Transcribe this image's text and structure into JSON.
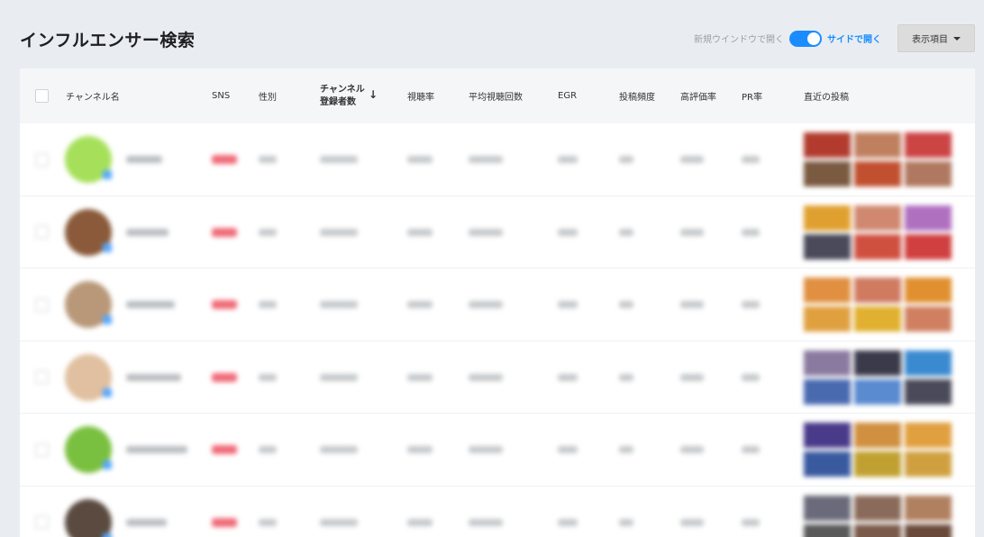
{
  "page": {
    "title": "インフルエンサー検索"
  },
  "controls": {
    "new_window_label": "新規ウインドウで開く",
    "toggle_on": true,
    "side_open_label": "サイドで開く",
    "columns_button_label": "表示項目",
    "accent_color": "#1a8cff"
  },
  "table": {
    "headers": {
      "channel_name": "チャンネル名",
      "sns": "SNS",
      "gender": "性別",
      "subscribers_line1": "チャンネル",
      "subscribers_line2": "登録者数",
      "sort_arrow": "↓",
      "view_rate": "視聴率",
      "avg_views": "平均視聴回数",
      "egr": "EGR",
      "post_frequency": "投稿頻度",
      "rating_rate": "高評価率",
      "pr_rate": "PR率",
      "recent_posts": "直近の投稿"
    },
    "rows": [
      {
        "avatar_color": "#a6e05a",
        "thumbs": [
          "#b23b2e",
          "#c08060",
          "#cc4444",
          "#7a5a40",
          "#c05030",
          "#b07860"
        ]
      },
      {
        "avatar_color": "#8a5a3a",
        "thumbs": [
          "#e0a030",
          "#d08870",
          "#b070c0",
          "#4a4a5a",
          "#d05040",
          "#d04040"
        ]
      },
      {
        "avatar_color": "#b89878",
        "thumbs": [
          "#e09040",
          "#d07a60",
          "#e09030",
          "#e0a040",
          "#e0b030",
          "#d08060"
        ]
      },
      {
        "avatar_color": "#e0c0a0",
        "thumbs": [
          "#8a7aa0",
          "#3a3a4a",
          "#3a8ad0",
          "#4a6ab0",
          "#5a8ad0",
          "#4a4a5a"
        ]
      },
      {
        "avatar_color": "#7ac040",
        "thumbs": [
          "#4a3a8a",
          "#d09040",
          "#e0a040",
          "#3a5aa0",
          "#c0a030",
          "#d0a040"
        ]
      },
      {
        "avatar_color": "#5a4a40",
        "thumbs": [
          "#6a6a7a",
          "#8a6a5a",
          "#b08060",
          "#5a5a5a",
          "#7a5a4a",
          "#6a4a3a"
        ]
      }
    ]
  }
}
